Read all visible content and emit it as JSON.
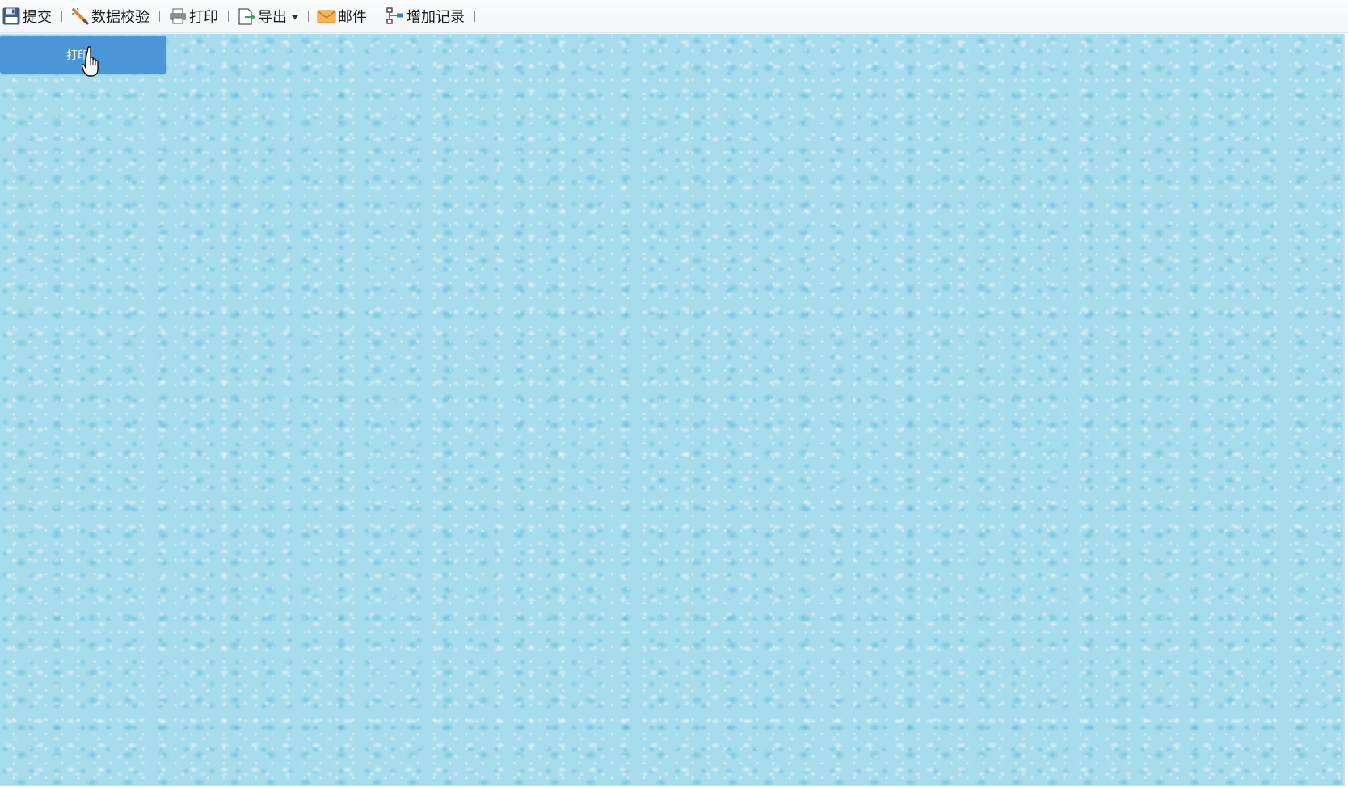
{
  "toolbar": {
    "items": [
      {
        "label": "提交",
        "icon": "save-icon"
      },
      {
        "label": "数据校验",
        "icon": "validate-icon"
      },
      {
        "label": "打印",
        "icon": "printer-icon"
      },
      {
        "label": "导出",
        "icon": "export-icon"
      },
      {
        "label": "邮件",
        "icon": "mail-icon"
      },
      {
        "label": "增加记录",
        "icon": "add-record-icon"
      }
    ]
  },
  "print_button": {
    "label": "打印"
  },
  "colors": {
    "button_blue": "#4a96d6",
    "canvas_bg": "#a6dcec",
    "toolbar_bg": "#f6f8fa"
  }
}
